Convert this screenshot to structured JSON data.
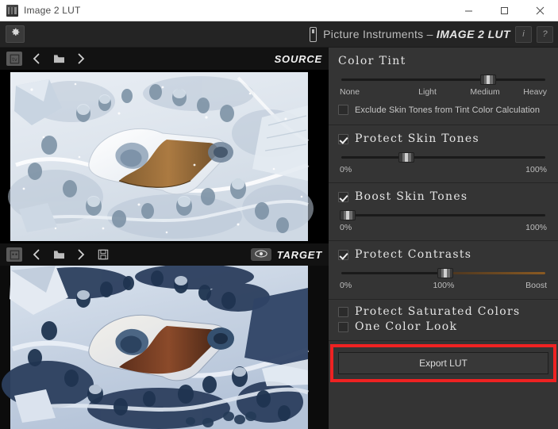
{
  "window": {
    "title": "Image 2 LUT",
    "minimize_label": "minimize",
    "maximize_label": "maximize",
    "close_label": "close"
  },
  "header": {
    "gear_icon": "gear-icon",
    "brand_prefix": "Picture Instruments – ",
    "brand_product": "IMAGE 2 LUT",
    "info_button": "i",
    "help_button": "?"
  },
  "source_panel": {
    "label": "SOURCE",
    "toolbar": [
      {
        "name": "screenshot-capture-button",
        "icon": "screenshot-icon"
      },
      {
        "name": "previous-image-button",
        "icon": "chevron-left-icon"
      },
      {
        "name": "open-folder-button",
        "icon": "folder-icon"
      },
      {
        "name": "next-image-button",
        "icon": "chevron-right-icon"
      }
    ]
  },
  "target_panel": {
    "label": "TARGET",
    "toolbar": [
      {
        "name": "screenshot-capture-button",
        "icon": "screenshot-icon"
      },
      {
        "name": "previous-image-button",
        "icon": "chevron-left-icon"
      },
      {
        "name": "open-folder-button",
        "icon": "folder-icon"
      },
      {
        "name": "next-image-button",
        "icon": "chevron-right-icon"
      },
      {
        "name": "save-image-button",
        "icon": "save-icon"
      }
    ],
    "preview_toggle_icon": "eye-icon"
  },
  "controls": {
    "color_tint": {
      "title": "Color Tint",
      "slider_value_pct": 72,
      "ticks": [
        "None",
        "Light",
        "Medium",
        "Heavy"
      ],
      "tick_positions_pct": [
        0,
        38,
        63,
        100
      ],
      "exclude_checkbox": {
        "label": "Exclude Skin Tones from Tint Color Calculation",
        "checked": false
      }
    },
    "protect_skin_tones": {
      "label": "Protect Skin Tones",
      "checked": true,
      "slider_value_pct": 32,
      "tick_min": "0%",
      "tick_max": "100%"
    },
    "boost_skin_tones": {
      "label": "Boost Skin Tones",
      "checked": true,
      "slider_value_pct": 3,
      "tick_min": "0%",
      "tick_max": "100%"
    },
    "protect_contrasts": {
      "label": "Protect Contrasts",
      "checked": true,
      "slider_value_pct": 51,
      "tick_min": "0%",
      "tick_mid": "100%",
      "tick_max": "Boost"
    },
    "protect_saturated_colors": {
      "label": "Protect Saturated Colors",
      "checked": false
    },
    "one_color_look": {
      "label": "One Color Look",
      "checked": false
    },
    "export": {
      "button_label": "Export LUT",
      "highlight_color": "#ee2222"
    }
  },
  "theme": {
    "panel_bg": "#343434",
    "header_bg": "#242424",
    "image_bg": "#0c0c0c",
    "accent_orange": "#8a5a22",
    "text": "#e4e4e4"
  }
}
